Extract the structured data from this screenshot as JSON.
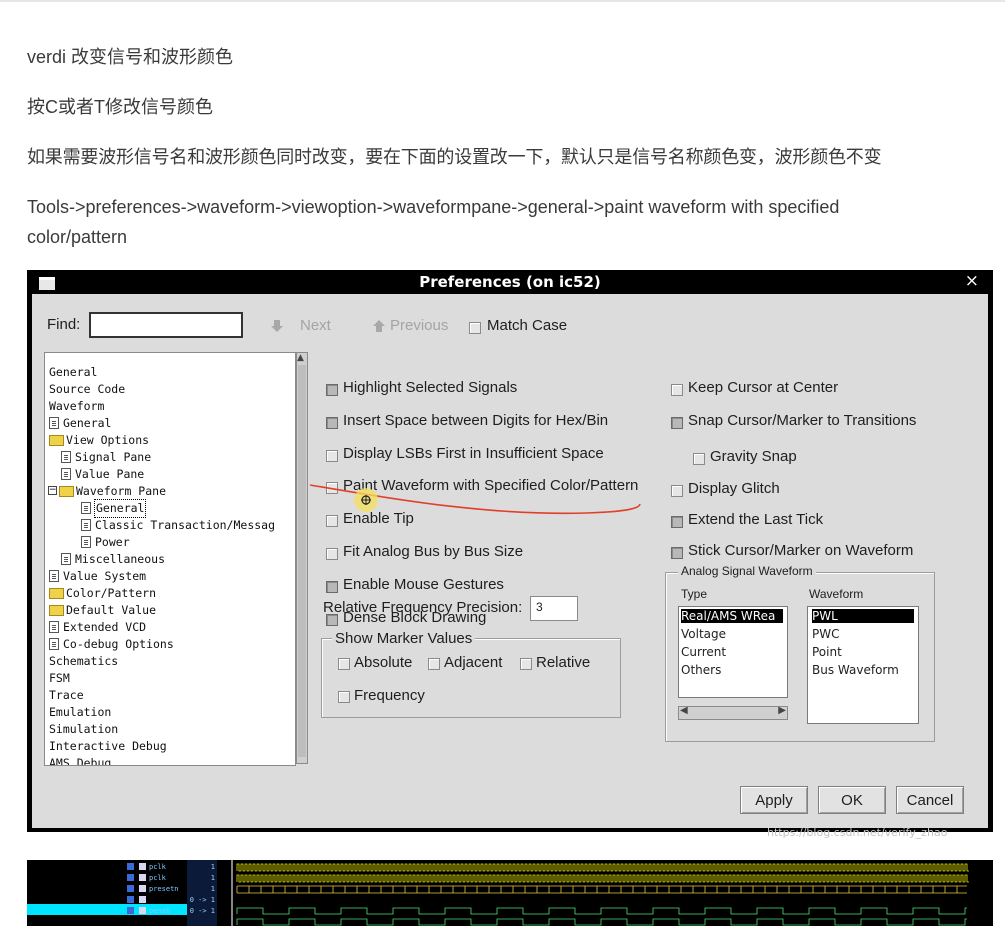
{
  "article": {
    "line1": "verdi 改变信号和波形颜色",
    "line2": "按C或者T修改信号颜色",
    "line3": "如果需要波形信号名和波形颜色同时改变，要在下面的设置改一下，默认只是信号名称颜色变，波形颜色不变",
    "line4a": "Tools->preferences->waveform->viewoption->waveformpane->general->paint waveform with specified",
    "line4b": "color/pattern"
  },
  "dialog": {
    "title": "Preferences (on ic52)",
    "close_glyph": "×",
    "find": {
      "label": "Find:",
      "value": ""
    },
    "next_label": "Next",
    "previous_label": "Previous",
    "match_case_label": "Match Case",
    "tree": [
      {
        "label": "General"
      },
      {
        "label": "Source Code"
      },
      {
        "label": "Waveform"
      },
      {
        "label": "General"
      },
      {
        "label": "View Options"
      },
      {
        "label": "Signal Pane"
      },
      {
        "label": "Value Pane"
      },
      {
        "label": "Waveform Pane"
      },
      {
        "label": "General",
        "selected": true
      },
      {
        "label": "Classic Transaction/Messag"
      },
      {
        "label": "Power"
      },
      {
        "label": "Miscellaneous"
      },
      {
        "label": "Value System"
      },
      {
        "label": "Color/Pattern"
      },
      {
        "label": "Default Value"
      },
      {
        "label": "Extended VCD"
      },
      {
        "label": "Co-debug Options"
      },
      {
        "label": "Schematics"
      },
      {
        "label": "FSM"
      },
      {
        "label": "Trace"
      },
      {
        "label": "Emulation"
      },
      {
        "label": "Simulation"
      },
      {
        "label": "Interactive Debug"
      },
      {
        "label": "AMS Debug"
      }
    ],
    "left_options": [
      {
        "label": "Highlight Selected Signals",
        "checked": true
      },
      {
        "label": "Insert Space between Digits for Hex/Bin",
        "checked": true
      },
      {
        "label": "Display LSBs First in Insufficient Space",
        "checked": false
      },
      {
        "label": "Paint Waveform with Specified Color/Pattern",
        "checked": false
      },
      {
        "label": "Enable Tip",
        "checked": false
      },
      {
        "label": "Fit Analog Bus by Bus Size",
        "checked": false
      },
      {
        "label": "Enable Mouse Gestures",
        "checked": true
      },
      {
        "label": "Dense Block Drawing",
        "checked": true
      }
    ],
    "rel_freq": {
      "label": "Relative Frequency Precision:",
      "value": "3"
    },
    "marker_group": {
      "title": "Show Marker Values",
      "absolute": "Absolute",
      "adjacent": "Adjacent",
      "relative": "Relative",
      "frequency": "Frequency"
    },
    "right_options": [
      {
        "label": "Keep Cursor at Center",
        "checked": false
      },
      {
        "label": "Snap Cursor/Marker to Transitions",
        "checked": true
      },
      {
        "label": "Gravity Snap",
        "checked": false
      },
      {
        "label": "Display Glitch",
        "checked": false
      },
      {
        "label": "Extend the Last Tick",
        "checked": true
      },
      {
        "label": "Stick Cursor/Marker on Waveform",
        "checked": true
      }
    ],
    "analog": {
      "title": "Analog Signal Waveform",
      "type_header": "Type",
      "waveform_header": "Waveform",
      "types": [
        "Real/AMS WRea",
        "Voltage",
        "Current",
        "Others"
      ],
      "waveforms": [
        "PWL",
        "PWC",
        "Point",
        "Bus Waveform"
      ]
    },
    "buttons": {
      "apply": "Apply",
      "ok": "OK",
      "cancel": "Cancel"
    },
    "watermark": "https://blog.csdn.net/verify_zhao"
  },
  "waveform_strip": {
    "signals": [
      "pclk",
      "pclk",
      "presetn",
      "psel",
      "penab"
    ],
    "values": [
      "1",
      "1",
      "1",
      "0 -> 1",
      "0 -> 1"
    ]
  },
  "colors": {
    "annotation": "#e0402a",
    "cursor_highlight": "#f5e06a",
    "selection_row": "#00e5ff",
    "wave": "#e8e800"
  }
}
